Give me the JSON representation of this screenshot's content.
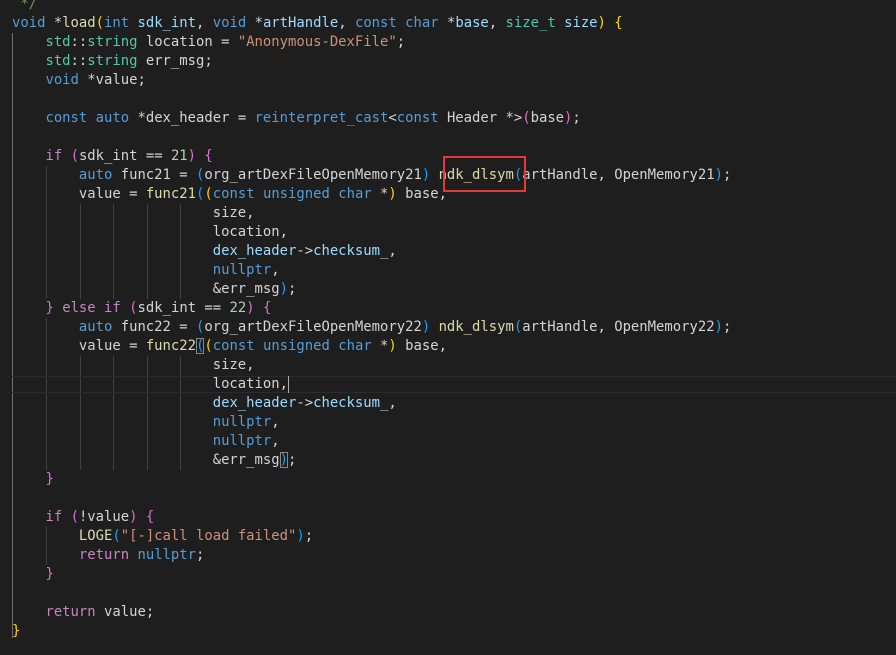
{
  "editor": {
    "language": "cpp",
    "theme_colors": {
      "background": "#1e1e1e",
      "text": "#d4d4d4",
      "keyword": "#569cd6",
      "control": "#c586c0",
      "function": "#dcdcaa",
      "string": "#ce9178",
      "namespace_type": "#4ec9b0",
      "variable": "#9cdcfe",
      "number": "#b5cea8",
      "comment": "#6a9955",
      "bracket_level_1": "#ffd700",
      "bracket_level_2": "#da70d6",
      "bracket_level_3": "#179fff",
      "annotation_box": "#e53935"
    },
    "annotation_text": "ndk_dlsym",
    "lines": [
      [
        [
          "cmt",
          " */"
        ]
      ],
      [
        [
          "kw",
          "void"
        ],
        [
          "txt",
          " *"
        ],
        [
          "fn",
          "load"
        ],
        [
          "b1",
          "("
        ],
        [
          "kw",
          "int"
        ],
        [
          "var",
          " sdk_int"
        ],
        [
          "txt",
          ", "
        ],
        [
          "kw",
          "void"
        ],
        [
          "txt",
          " *"
        ],
        [
          "var",
          "artHandle"
        ],
        [
          "txt",
          ", "
        ],
        [
          "kw",
          "const"
        ],
        [
          "txt",
          " "
        ],
        [
          "kw",
          "char"
        ],
        [
          "txt",
          " *"
        ],
        [
          "var",
          "base"
        ],
        [
          "txt",
          ", "
        ],
        [
          "ns",
          "size_t"
        ],
        [
          "txt",
          " "
        ],
        [
          "var",
          "size"
        ],
        [
          "b1",
          ")"
        ],
        [
          "txt",
          " "
        ],
        [
          "b1",
          "{"
        ]
      ],
      [
        [
          "txt",
          "    "
        ],
        [
          "ns",
          "std"
        ],
        [
          "txt",
          "::"
        ],
        [
          "ns",
          "string"
        ],
        [
          "txt",
          " location = "
        ],
        [
          "str",
          "\"Anonymous-DexFile\""
        ],
        [
          "txt",
          ";"
        ]
      ],
      [
        [
          "txt",
          "    "
        ],
        [
          "ns",
          "std"
        ],
        [
          "txt",
          "::"
        ],
        [
          "ns",
          "string"
        ],
        [
          "txt",
          " err_msg;"
        ]
      ],
      [
        [
          "txt",
          "    "
        ],
        [
          "kw",
          "void"
        ],
        [
          "txt",
          " *value;"
        ]
      ],
      [
        [
          "txt",
          ""
        ]
      ],
      [
        [
          "txt",
          "    "
        ],
        [
          "kw",
          "const"
        ],
        [
          "txt",
          " "
        ],
        [
          "kw",
          "auto"
        ],
        [
          "txt",
          " *dex_header = "
        ],
        [
          "kw",
          "reinterpret_cast"
        ],
        [
          "txt",
          "<"
        ],
        [
          "kw",
          "const"
        ],
        [
          "txt",
          " Header *>"
        ],
        [
          "b2",
          "("
        ],
        [
          "txt",
          "base"
        ],
        [
          "b2",
          ")"
        ],
        [
          "txt",
          ";"
        ]
      ],
      [
        [
          "txt",
          ""
        ]
      ],
      [
        [
          "txt",
          "    "
        ],
        [
          "ctl",
          "if"
        ],
        [
          "txt",
          " "
        ],
        [
          "b2",
          "("
        ],
        [
          "txt",
          "sdk_int == "
        ],
        [
          "num",
          "21"
        ],
        [
          "b2",
          ")"
        ],
        [
          "txt",
          " "
        ],
        [
          "b2",
          "{"
        ]
      ],
      [
        [
          "txt",
          "        "
        ],
        [
          "kw",
          "auto"
        ],
        [
          "txt",
          " func21 = "
        ],
        [
          "b3",
          "("
        ],
        [
          "txt",
          "org_artDexFileOpenMemory21"
        ],
        [
          "b3",
          ")"
        ],
        [
          "txt",
          " "
        ],
        [
          "fn",
          "ndk_dlsym"
        ],
        [
          "b3",
          "("
        ],
        [
          "txt",
          "artHandle, OpenMemory21"
        ],
        [
          "b3",
          ")"
        ],
        [
          "txt",
          ";"
        ]
      ],
      [
        [
          "txt",
          "        value = "
        ],
        [
          "fn",
          "func21"
        ],
        [
          "b3",
          "("
        ],
        [
          "b1",
          "("
        ],
        [
          "kw",
          "const"
        ],
        [
          "txt",
          " "
        ],
        [
          "kw",
          "unsigned"
        ],
        [
          "txt",
          " "
        ],
        [
          "kw",
          "char"
        ],
        [
          "txt",
          " *"
        ],
        [
          "b1",
          ")"
        ],
        [
          "txt",
          " base,"
        ]
      ],
      [
        [
          "txt",
          "                        size,"
        ]
      ],
      [
        [
          "txt",
          "                        location,"
        ]
      ],
      [
        [
          "txt",
          "                        "
        ],
        [
          "var",
          "dex_header"
        ],
        [
          "txt",
          "->"
        ],
        [
          "var",
          "checksum_"
        ],
        [
          "txt",
          ","
        ]
      ],
      [
        [
          "txt",
          "                        "
        ],
        [
          "kw",
          "nullptr"
        ],
        [
          "txt",
          ","
        ]
      ],
      [
        [
          "txt",
          "                        &err_msg"
        ],
        [
          "b3",
          ")"
        ],
        [
          "txt",
          ";"
        ]
      ],
      [
        [
          "txt",
          "    "
        ],
        [
          "b2",
          "}"
        ],
        [
          "txt",
          " "
        ],
        [
          "ctl",
          "else"
        ],
        [
          "txt",
          " "
        ],
        [
          "ctl",
          "if"
        ],
        [
          "txt",
          " "
        ],
        [
          "b2",
          "("
        ],
        [
          "txt",
          "sdk_int == "
        ],
        [
          "num",
          "22"
        ],
        [
          "b2",
          ")"
        ],
        [
          "txt",
          " "
        ],
        [
          "b2",
          "{"
        ]
      ],
      [
        [
          "txt",
          "        "
        ],
        [
          "kw",
          "auto"
        ],
        [
          "txt",
          " func22 = "
        ],
        [
          "b3",
          "("
        ],
        [
          "txt",
          "org_artDexFileOpenMemory22"
        ],
        [
          "b3",
          ")"
        ],
        [
          "txt",
          " "
        ],
        [
          "fn",
          "ndk_dlsym"
        ],
        [
          "b3",
          "("
        ],
        [
          "txt",
          "artHandle, OpenMemory22"
        ],
        [
          "b3",
          ")"
        ],
        [
          "txt",
          ";"
        ]
      ],
      [
        [
          "txt",
          "        value = "
        ],
        [
          "fn",
          "func22"
        ],
        [
          "b3m",
          "("
        ],
        [
          "b1",
          "("
        ],
        [
          "kw",
          "const"
        ],
        [
          "txt",
          " "
        ],
        [
          "kw",
          "unsigned"
        ],
        [
          "txt",
          " "
        ],
        [
          "kw",
          "char"
        ],
        [
          "txt",
          " *"
        ],
        [
          "b1",
          ")"
        ],
        [
          "txt",
          " base,"
        ]
      ],
      [
        [
          "txt",
          "                        size,"
        ]
      ],
      [
        [
          "txt",
          "                        location,"
        ],
        [
          "caret",
          ""
        ]
      ],
      [
        [
          "txt",
          "                        "
        ],
        [
          "var",
          "dex_header"
        ],
        [
          "txt",
          "->"
        ],
        [
          "var",
          "checksum_"
        ],
        [
          "txt",
          ","
        ]
      ],
      [
        [
          "txt",
          "                        "
        ],
        [
          "kw",
          "nullptr"
        ],
        [
          "txt",
          ","
        ]
      ],
      [
        [
          "txt",
          "                        "
        ],
        [
          "kw",
          "nullptr"
        ],
        [
          "txt",
          ","
        ]
      ],
      [
        [
          "txt",
          "                        &err_msg"
        ],
        [
          "b3m",
          ")"
        ],
        [
          "txt",
          ";"
        ]
      ],
      [
        [
          "txt",
          "    "
        ],
        [
          "b2",
          "}"
        ]
      ],
      [
        [
          "txt",
          ""
        ]
      ],
      [
        [
          "txt",
          "    "
        ],
        [
          "ctl",
          "if"
        ],
        [
          "txt",
          " "
        ],
        [
          "b2",
          "("
        ],
        [
          "txt",
          "!value"
        ],
        [
          "b2",
          ")"
        ],
        [
          "txt",
          " "
        ],
        [
          "b2",
          "{"
        ]
      ],
      [
        [
          "txt",
          "        "
        ],
        [
          "fn",
          "LOGE"
        ],
        [
          "b3",
          "("
        ],
        [
          "str",
          "\"[-]call load failed\""
        ],
        [
          "b3",
          ")"
        ],
        [
          "txt",
          ";"
        ]
      ],
      [
        [
          "txt",
          "        "
        ],
        [
          "ctl",
          "return"
        ],
        [
          "txt",
          " "
        ],
        [
          "kw",
          "nullptr"
        ],
        [
          "txt",
          ";"
        ]
      ],
      [
        [
          "txt",
          "    "
        ],
        [
          "b2",
          "}"
        ]
      ],
      [
        [
          "txt",
          ""
        ]
      ],
      [
        [
          "txt",
          "    "
        ],
        [
          "ctl",
          "return"
        ],
        [
          "txt",
          " value;"
        ]
      ],
      [
        [
          "b1",
          "}"
        ]
      ]
    ]
  }
}
